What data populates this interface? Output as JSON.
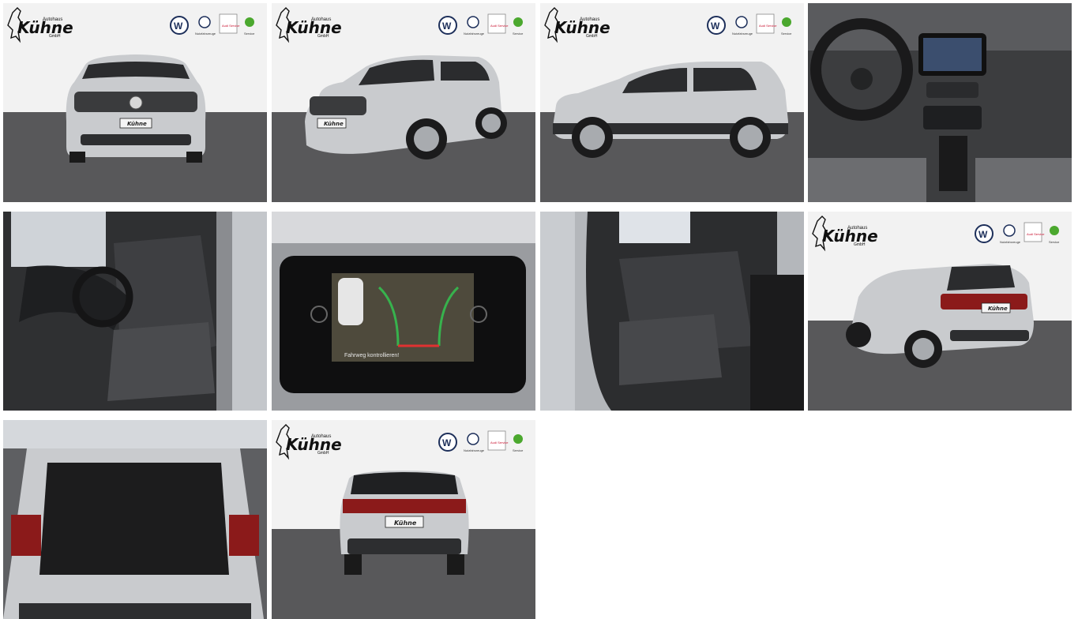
{
  "gallery": {
    "dealer": {
      "name": "Kühne",
      "prefix": "Autohaus",
      "suffix": "GmbH"
    },
    "brand_captions": {
      "vw_commercial": "Nutzfahrzeuge",
      "audi": "Audi Service",
      "skoda": "Service"
    },
    "plate_text": "Kühne",
    "screen_caption": "Fahrweg kontrollieren!",
    "photos": [
      {
        "label": "Frontansicht"
      },
      {
        "label": "Front links schräg"
      },
      {
        "label": "Seitenansicht links"
      },
      {
        "label": "Cockpit"
      },
      {
        "label": "Fahrersitz"
      },
      {
        "label": "Rückfahrkamera"
      },
      {
        "label": "Rücksitze"
      },
      {
        "label": "Heck links schräg"
      },
      {
        "label": "Kofferraum"
      },
      {
        "label": "Heckansicht"
      }
    ],
    "colors": {
      "floor": "#58585a",
      "wall": "#f2f2f2",
      "car_silver": "#c9cbce",
      "interior_dark": "#2b2c2e",
      "vw_blue": "#1d2f5a",
      "skoda_green": "#4ba82e",
      "audi_red": "#c8102e"
    }
  }
}
